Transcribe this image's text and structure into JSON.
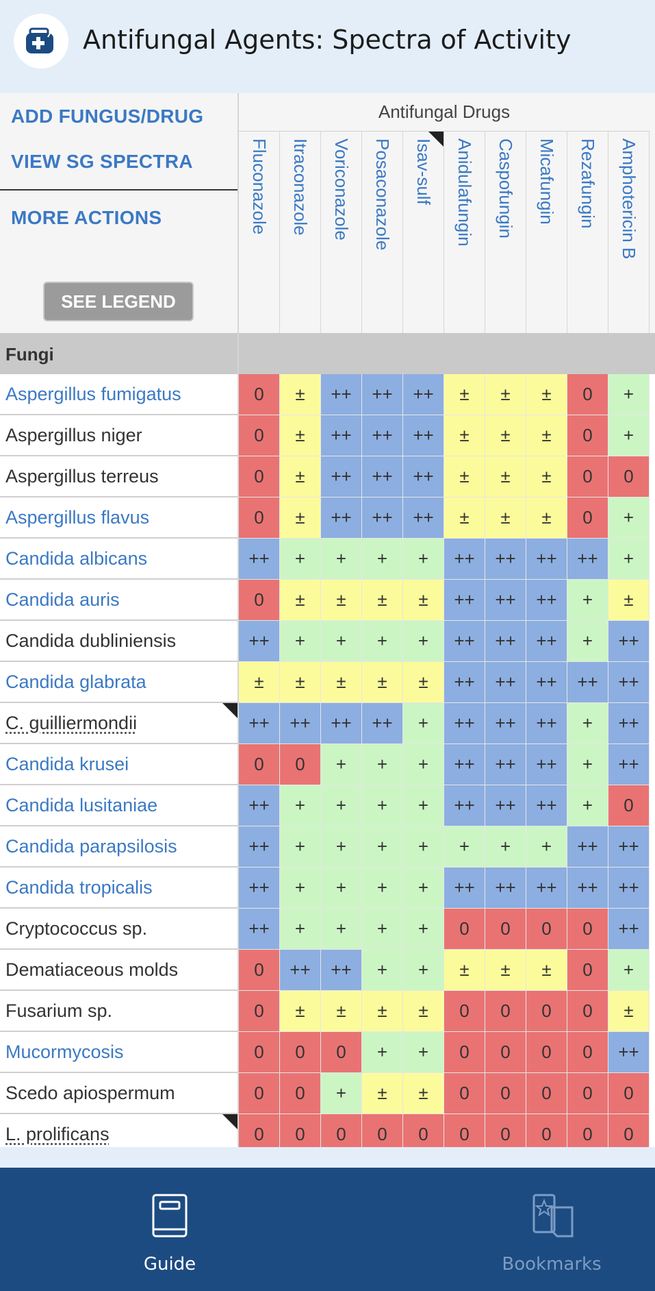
{
  "header": {
    "title": "Antifungal Agents: Spectra of Activity",
    "icon": "medical-bag-icon"
  },
  "actions": {
    "add": "ADD FUNGUS/DRUG",
    "view": "VIEW SG SPECTRA",
    "more": "MORE ACTIONS",
    "legend": "SEE LEGEND"
  },
  "columns_label": "Antifungal Drugs",
  "drugs": [
    "Fluconazole",
    "Itraconazole",
    "Voriconazole",
    "Posaconazole",
    "Isav-sulf",
    "Anidulafungin",
    "Caspofungin",
    "Micafungin",
    "Rezafungin",
    "Amphotericin B"
  ],
  "drug_notes": [
    false,
    false,
    false,
    false,
    true,
    false,
    false,
    false,
    false,
    false
  ],
  "section_label": "Fungi",
  "colors": {
    "0": "#e97373",
    "±": "#fcfb9b",
    "+": "#ccf5c4",
    "++": "#8daee0"
  },
  "rows": [
    {
      "name": "Aspergillus fumigatus",
      "link": true,
      "note": false,
      "values": [
        "0",
        "±",
        "++",
        "++",
        "++",
        "±",
        "±",
        "±",
        "0",
        "+"
      ]
    },
    {
      "name": "Aspergillus niger",
      "link": false,
      "note": false,
      "values": [
        "0",
        "±",
        "++",
        "++",
        "++",
        "±",
        "±",
        "±",
        "0",
        "+"
      ]
    },
    {
      "name": "Aspergillus terreus",
      "link": false,
      "note": false,
      "values": [
        "0",
        "±",
        "++",
        "++",
        "++",
        "±",
        "±",
        "±",
        "0",
        "0"
      ]
    },
    {
      "name": "Aspergillus flavus",
      "link": true,
      "note": false,
      "values": [
        "0",
        "±",
        "++",
        "++",
        "++",
        "±",
        "±",
        "±",
        "0",
        "+"
      ]
    },
    {
      "name": "Candida albicans",
      "link": true,
      "note": false,
      "values": [
        "++",
        "+",
        "+",
        "+",
        "+",
        "++",
        "++",
        "++",
        "++",
        "+"
      ]
    },
    {
      "name": "Candida auris",
      "link": true,
      "note": false,
      "values": [
        "0",
        "±",
        "±",
        "±",
        "±",
        "++",
        "++",
        "++",
        "+",
        "±"
      ]
    },
    {
      "name": "Candida dubliniensis",
      "link": false,
      "note": false,
      "values": [
        "++",
        "+",
        "+",
        "+",
        "+",
        "++",
        "++",
        "++",
        "+",
        "++"
      ]
    },
    {
      "name": "Candida glabrata",
      "link": true,
      "note": false,
      "values": [
        "±",
        "±",
        "±",
        "±",
        "±",
        "++",
        "++",
        "++",
        "++",
        "++"
      ]
    },
    {
      "name": "C. guilliermondii",
      "link": false,
      "note": true,
      "values": [
        "++",
        "++",
        "++",
        "++",
        "+",
        "++",
        "++",
        "++",
        "+",
        "++"
      ]
    },
    {
      "name": "Candida krusei",
      "link": true,
      "note": false,
      "values": [
        "0",
        "0",
        "+",
        "+",
        "+",
        "++",
        "++",
        "++",
        "+",
        "++"
      ]
    },
    {
      "name": "Candida lusitaniae",
      "link": true,
      "note": false,
      "values": [
        "++",
        "+",
        "+",
        "+",
        "+",
        "++",
        "++",
        "++",
        "+",
        "0"
      ]
    },
    {
      "name": "Candida parapsilosis",
      "link": true,
      "note": false,
      "values": [
        "++",
        "+",
        "+",
        "+",
        "+",
        "+",
        "+",
        "+",
        "++",
        "++"
      ]
    },
    {
      "name": "Candida tropicalis",
      "link": true,
      "note": false,
      "values": [
        "++",
        "+",
        "+",
        "+",
        "+",
        "++",
        "++",
        "++",
        "++",
        "++"
      ]
    },
    {
      "name": "Cryptococcus sp.",
      "link": false,
      "note": false,
      "values": [
        "++",
        "+",
        "+",
        "+",
        "+",
        "0",
        "0",
        "0",
        "0",
        "++"
      ]
    },
    {
      "name": "Dematiaceous molds",
      "link": false,
      "note": false,
      "values": [
        "0",
        "++",
        "++",
        "+",
        "+",
        "±",
        "±",
        "±",
        "0",
        "+"
      ]
    },
    {
      "name": "Fusarium sp.",
      "link": false,
      "note": false,
      "values": [
        "0",
        "±",
        "±",
        "±",
        "±",
        "0",
        "0",
        "0",
        "0",
        "±"
      ]
    },
    {
      "name": "Mucormycosis",
      "link": true,
      "note": false,
      "values": [
        "0",
        "0",
        "0",
        "+",
        "+",
        "0",
        "0",
        "0",
        "0",
        "++"
      ]
    },
    {
      "name": "Scedo apiospermum",
      "link": false,
      "note": false,
      "values": [
        "0",
        "0",
        "+",
        "±",
        "±",
        "0",
        "0",
        "0",
        "0",
        "0"
      ]
    },
    {
      "name": "L. prolificans",
      "link": false,
      "note": true,
      "values": [
        "0",
        "0",
        "0",
        "0",
        "0",
        "0",
        "0",
        "0",
        "0",
        "0"
      ]
    }
  ],
  "tabs": [
    {
      "label": "Guide",
      "icon": "book-icon",
      "active": true
    },
    {
      "label": "Bookmarks",
      "icon": "bookmarks-icon",
      "active": false
    }
  ]
}
